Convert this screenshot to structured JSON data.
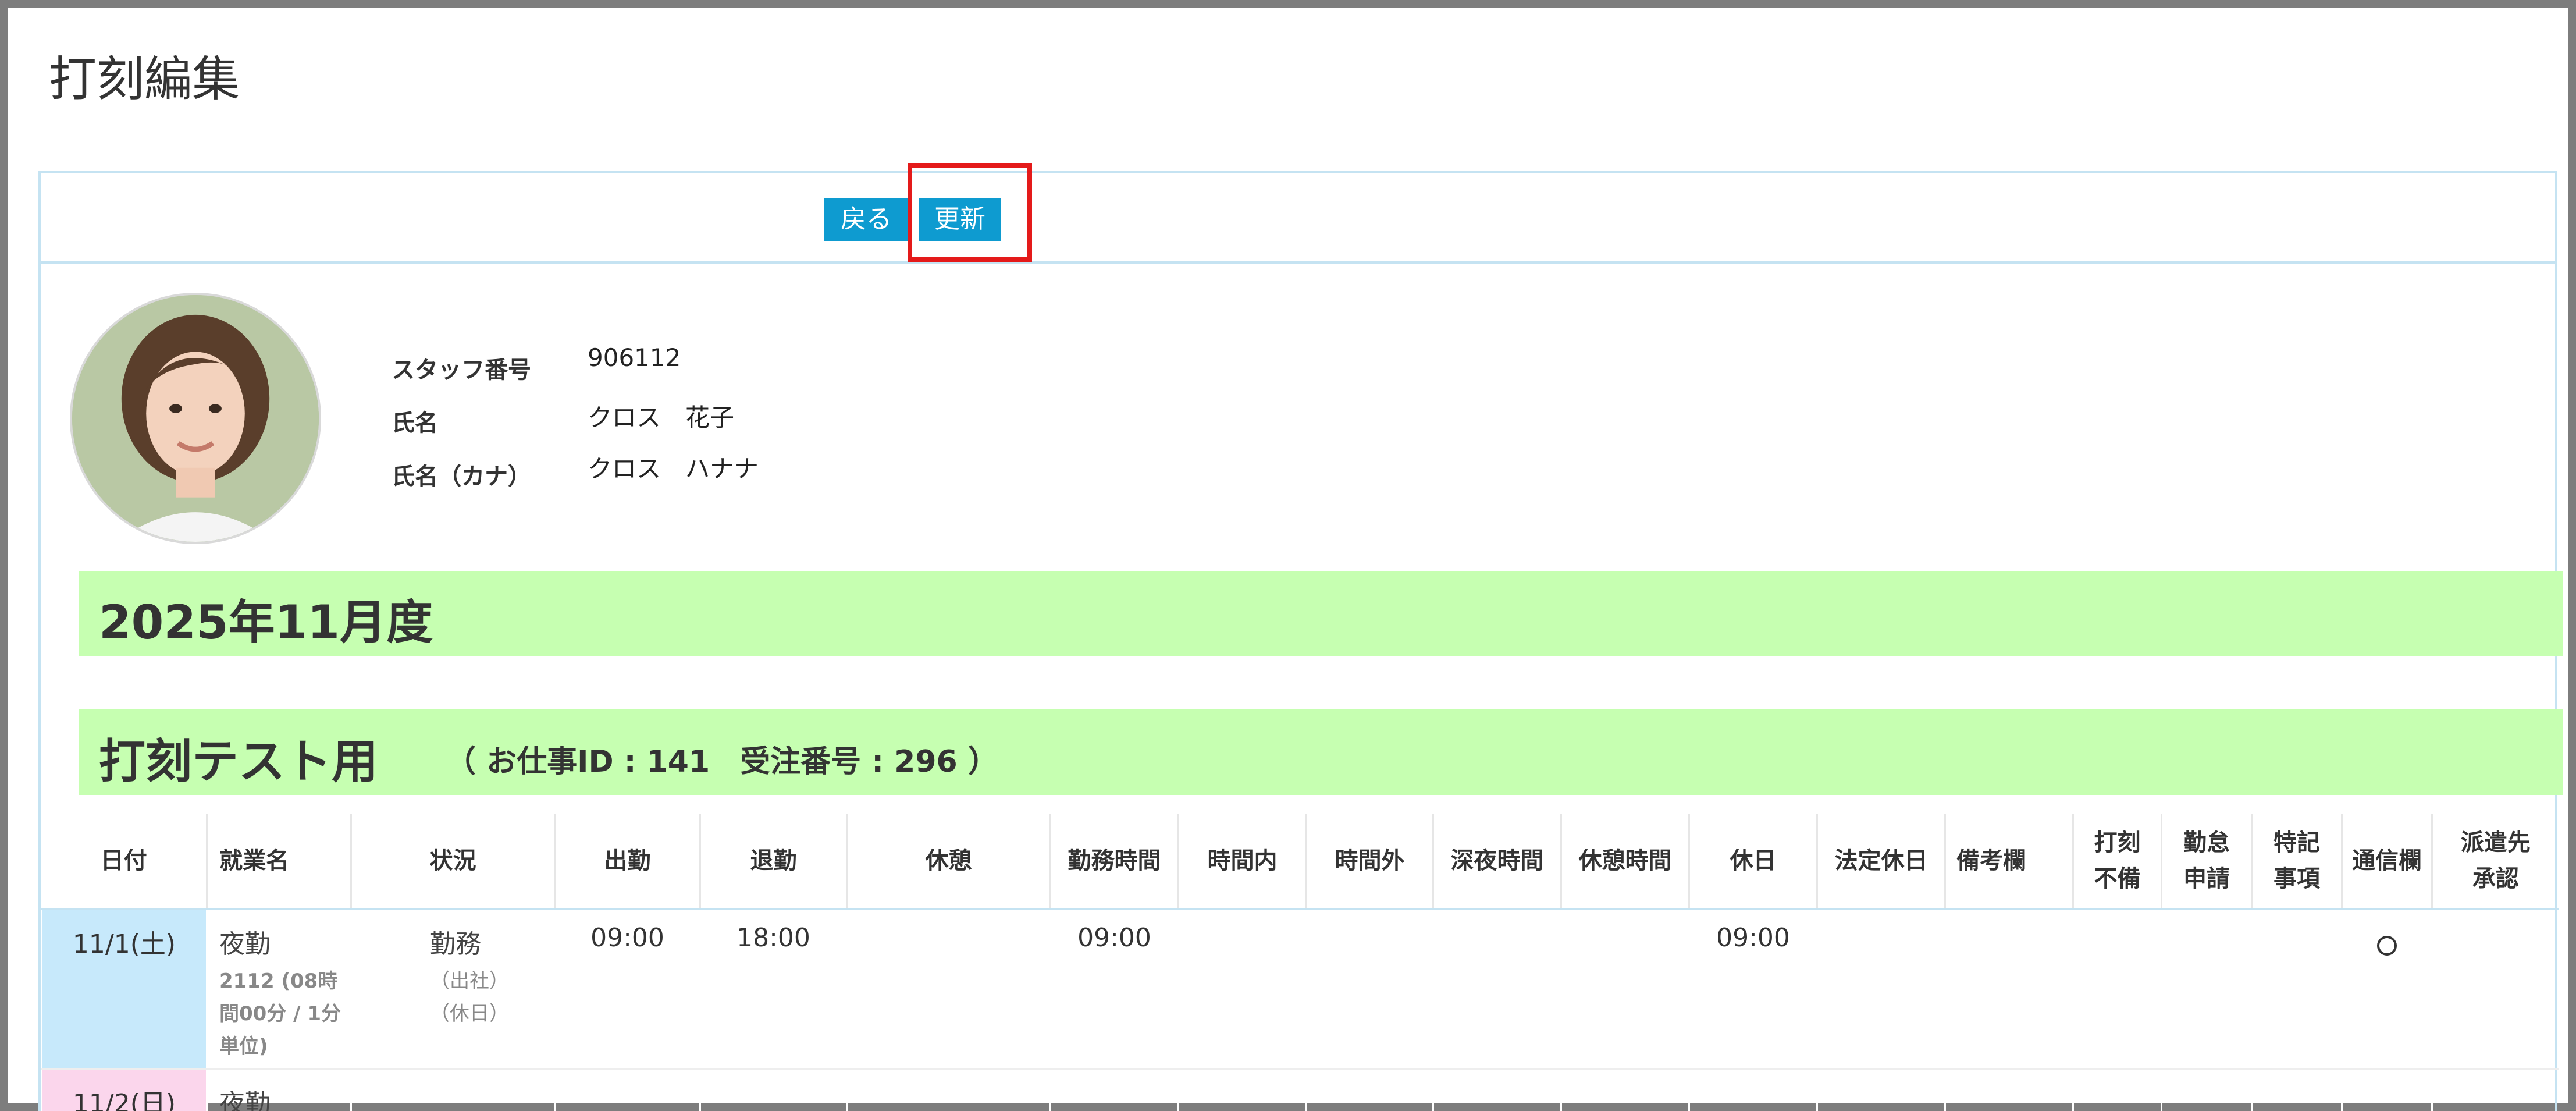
{
  "page": {
    "title": "打刻編集"
  },
  "toolbar": {
    "back_label": "戻る",
    "update_label": "更新"
  },
  "staff": {
    "number_label": "スタッフ番号",
    "number_value": "906112",
    "name_label": "氏名",
    "name_value": "クロス　花子",
    "kana_label": "氏名（カナ）",
    "kana_value": "クロス　ハナナ"
  },
  "period": {
    "title": "2025年11月度"
  },
  "job": {
    "title": "打刻テスト用",
    "meta": "（ お仕事ID : 141　受注番号 : 296 ）"
  },
  "table": {
    "headers": {
      "date": "日付",
      "job": "就業名",
      "status": "状況",
      "clock_in": "出勤",
      "clock_out": "退勤",
      "break": "休憩",
      "work_hours": "勤務時間",
      "within_hours": "時間内",
      "overtime": "時間外",
      "late_night": "深夜時間",
      "break_hours": "休憩時間",
      "holiday": "休日",
      "legal_holiday": "法定休日",
      "remarks": "備考欄",
      "missing_line1": "打刻",
      "missing_line2": "不備",
      "request_line1": "勤怠",
      "request_line2": "申請",
      "special_line1": "特記",
      "special_line2": "事項",
      "comm": "通信欄",
      "dispatch_line1": "派遣先",
      "dispatch_line2": "承認"
    },
    "rows": [
      {
        "date": "11/1(土)",
        "job_name": "夜勤",
        "job_detail": "2112 (08時間00分 / 1分単位)",
        "status": "勤務",
        "status_sub1": "（出社）",
        "status_sub2": "（休日）",
        "clock_in": "09:00",
        "clock_out": "18:00",
        "work_hours": "09:00",
        "holiday": "09:00",
        "comm_mark": "○"
      },
      {
        "date": "11/2(日)",
        "job_name": "夜勤"
      }
    ]
  }
}
